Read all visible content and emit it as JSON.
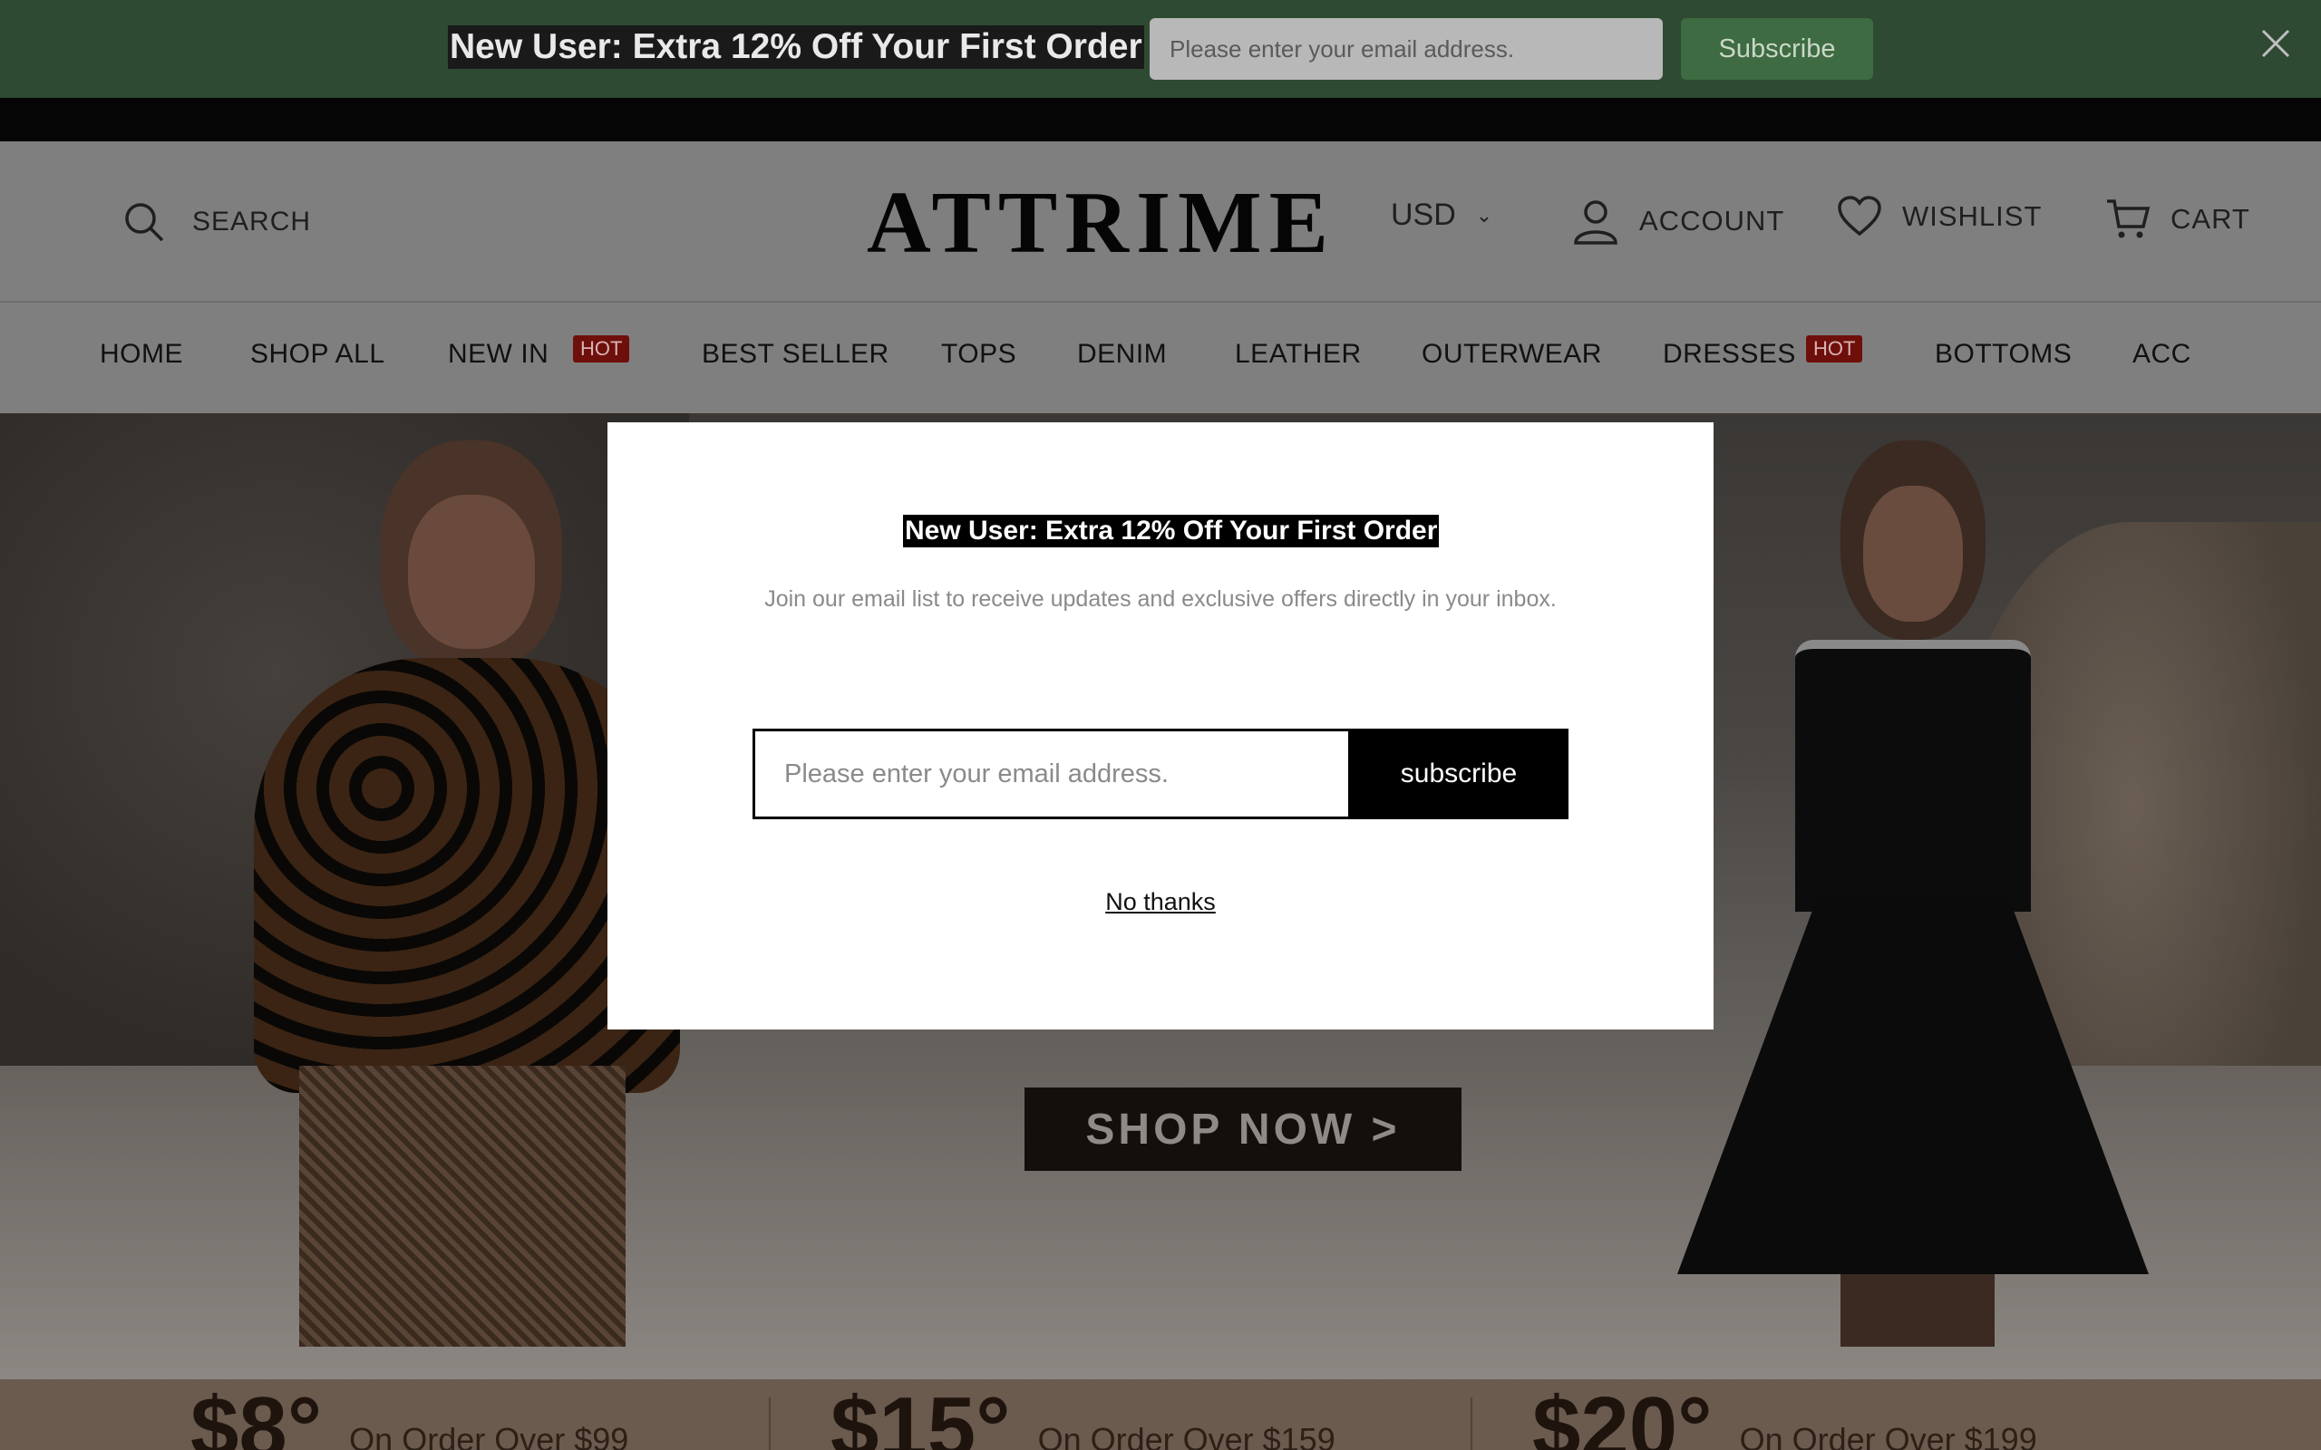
{
  "promo_bar": {
    "text": "New User: Extra 12% Off Your First Order",
    "email_placeholder": "Please enter your email address.",
    "subscribe_label": "Subscribe",
    "close_icon": "close-icon"
  },
  "header": {
    "search_label": "SEARCH",
    "logo": "ATTRIME",
    "currency": "USD",
    "account_label": "ACCOUNT",
    "wishlist_label": "WISHLIST",
    "cart_label": "CART"
  },
  "menu": {
    "items": [
      "HOME",
      "SHOP ALL",
      "NEW IN",
      "BEST SELLER",
      "TOPS",
      "DENIM",
      "LEATHER",
      "OUTERWEAR",
      "DRESSES",
      "BOTTOMS",
      "ACC"
    ],
    "hot_badge": "HOT"
  },
  "hero": {
    "cta_label": "SHOP NOW >"
  },
  "offers": [
    {
      "amount": "$8°",
      "condition": "On Order Over $99"
    },
    {
      "amount": "$15°",
      "condition": "On Order Over $159"
    },
    {
      "amount": "$20°",
      "condition": "On Order Over $199"
    }
  ],
  "modal": {
    "title": "New User: Extra 12% Off Your First Order",
    "description": "Join our email list to receive updates and exclusive offers directly in your inbox.",
    "email_placeholder": "Please enter your email address.",
    "subscribe_label": "subscribe",
    "no_thanks_label": "No thanks"
  },
  "colors": {
    "promo_bg": "#2f4a32",
    "subscribe_green": "#3e6b41",
    "hot_badge": "#6e0f0c"
  }
}
